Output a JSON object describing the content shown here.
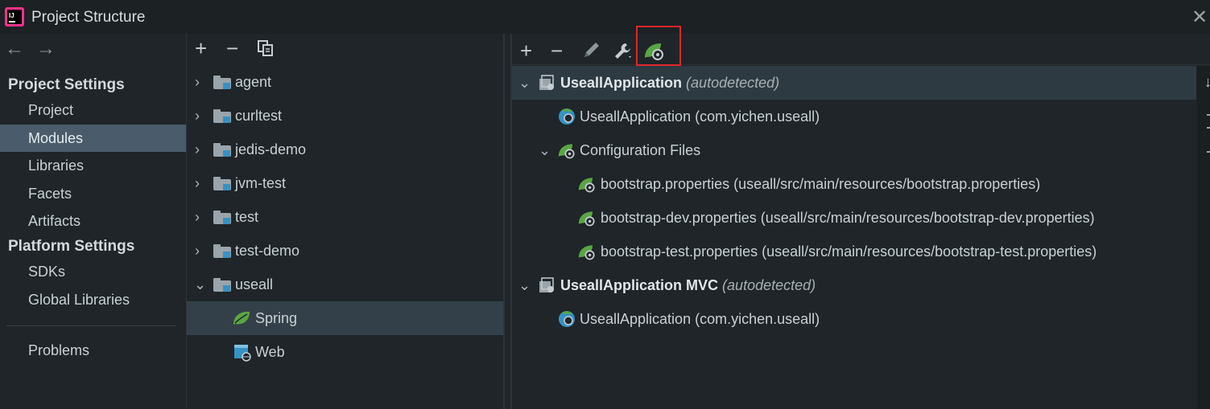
{
  "window": {
    "title": "Project Structure",
    "logo_text": "IJ"
  },
  "nav": {
    "back_icon": "arrow-left-icon",
    "forward_icon": "arrow-right-icon",
    "project_settings_header": "Project Settings",
    "project_settings_items": [
      "Project",
      "Modules",
      "Libraries",
      "Facets",
      "Artifacts"
    ],
    "platform_settings_header": "Platform Settings",
    "platform_settings_items": [
      "SDKs",
      "Global Libraries"
    ],
    "problems": "Problems",
    "selected": "Modules"
  },
  "modules": {
    "toolbar": [
      "add-icon",
      "remove-icon",
      "copy-icon"
    ],
    "tree": [
      {
        "label": "agent",
        "expanded": false
      },
      {
        "label": "curltest",
        "expanded": false
      },
      {
        "label": "jedis-demo",
        "expanded": false
      },
      {
        "label": "jvm-test",
        "expanded": false
      },
      {
        "label": "test",
        "expanded": false
      },
      {
        "label": "test-demo",
        "expanded": false
      },
      {
        "label": "useall",
        "expanded": true
      },
      {
        "label": "Spring",
        "child": true,
        "selected": true,
        "icon": "spring-leaf-icon"
      },
      {
        "label": "Web",
        "child": true,
        "icon": "web-icon"
      }
    ]
  },
  "spring": {
    "toolbar": [
      "add-icon",
      "remove-icon",
      "edit-icon",
      "wrench-icon",
      "spring-config-icon"
    ],
    "highlighted_tool": "spring-config-icon",
    "rows": [
      {
        "bold": "UseallApplication",
        "italic": "(autodetected)"
      },
      {
        "text": "UseallApplication (com.yichen.useall)"
      },
      {
        "text": "Configuration Files"
      },
      {
        "text": "bootstrap.properties (useall/src/main/resources/bootstrap.properties)"
      },
      {
        "text": "bootstrap-dev.properties (useall/src/main/resources/bootstrap-dev.properties)"
      },
      {
        "text": "bootstrap-test.properties (useall/src/main/resources/bootstrap-test.properties)"
      },
      {
        "bold": "UseallApplication MVC",
        "italic": "(autodetected)"
      },
      {
        "text": "UseallApplication (com.yichen.useall)"
      }
    ]
  },
  "colors": {
    "accent_selected": "#4a5c6b",
    "spring_green": "#5aa544",
    "highlight_red": "#e0262b",
    "folder_blue": "#3592c4"
  }
}
